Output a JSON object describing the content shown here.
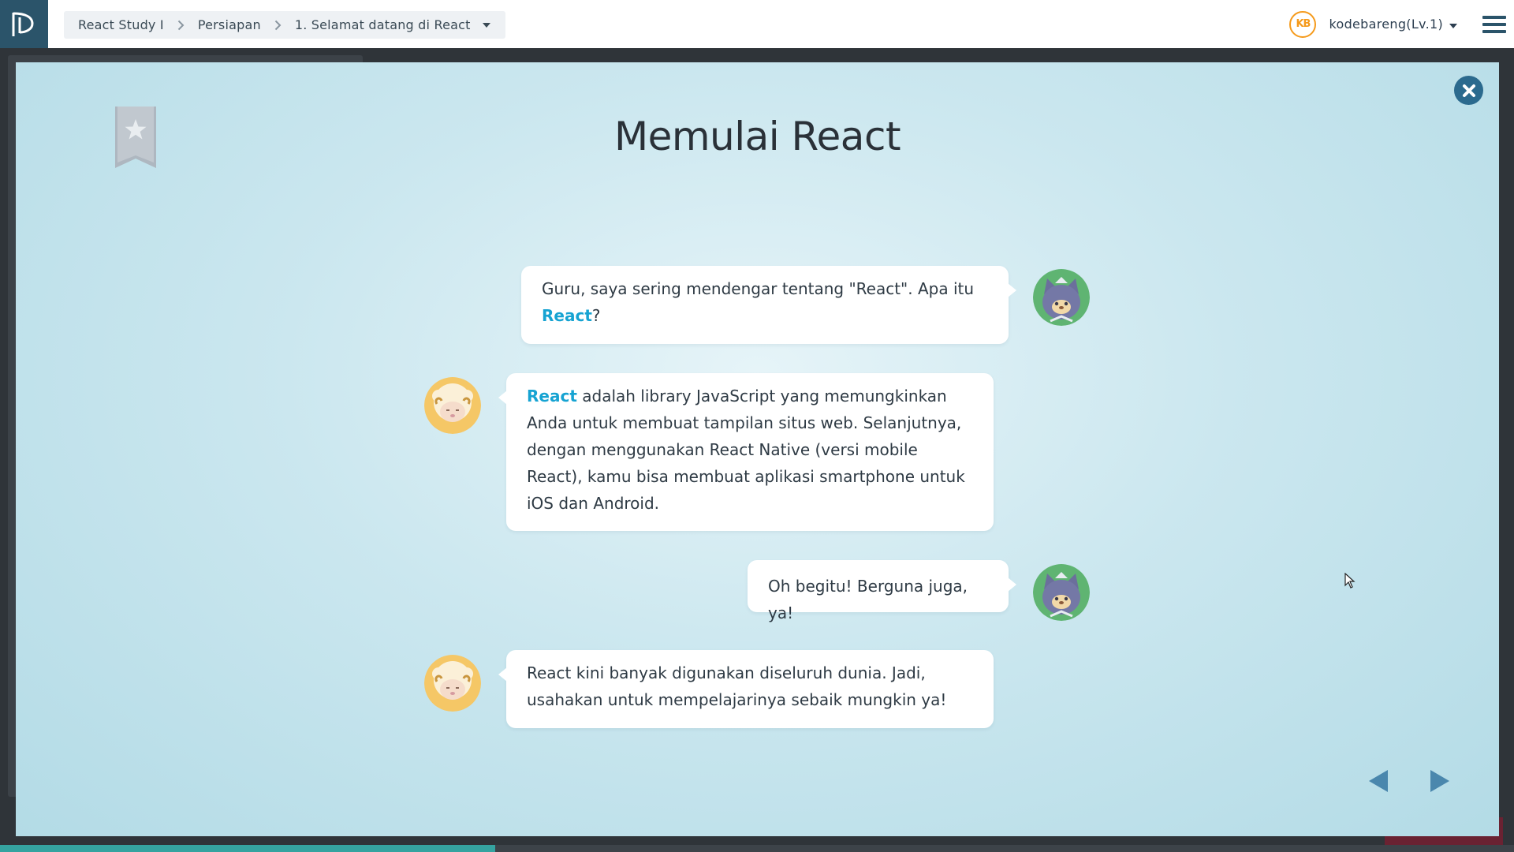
{
  "topbar": {
    "logo_icon": "progate-logo-icon",
    "breadcrumb": {
      "course": "React Study I",
      "chapter": "Persiapan",
      "lesson": "1. Selamat datang di React"
    },
    "user": {
      "badge": "KB",
      "name": "kodebareng(Lv.1)"
    }
  },
  "modal": {
    "title": "Memulai React",
    "messages": [
      {
        "speaker": "student",
        "parts": [
          "Guru, saya sering mendengar tentang \"React\". Apa itu ",
          "React",
          "?"
        ]
      },
      {
        "speaker": "teacher",
        "parts": [
          "React",
          " adalah library JavaScript yang memungkinkan Anda untuk membuat tampilan situs web. Selanjutnya, dengan menggunakan React Native (versi mobile React), kamu bisa membuat aplikasi smartphone untuk iOS dan Android."
        ]
      },
      {
        "speaker": "student",
        "parts": [
          "Oh begitu! Berguna juga, ya!"
        ]
      },
      {
        "speaker": "teacher",
        "parts": [
          "React kini banyak digunakan diseluruh dunia. Jadi, usahakan untuk mempelajarinya sebaik mungkin ya!"
        ]
      }
    ]
  },
  "colors": {
    "accent": "#16a3d2",
    "header_dark": "#2b546a",
    "user_badge": "#f59a1b",
    "progress": "#35a3a0"
  },
  "progress": 0.327
}
